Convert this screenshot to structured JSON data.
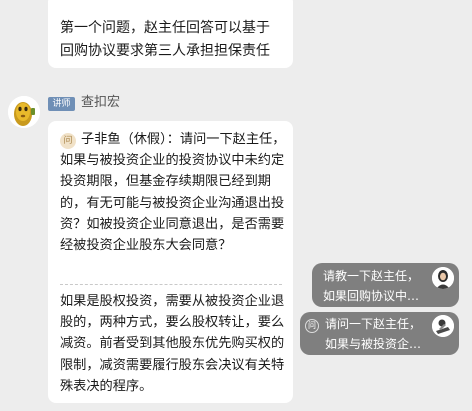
{
  "previous_message": {
    "text": "第一个问题，赵主任回答可以基于回购协议要求第三人承担担保责任"
  },
  "message": {
    "role_badge": "讲师",
    "sender": "查扣宏",
    "avatar": "yellow-cartoon-avatar",
    "quote_icon": "问",
    "quoted_question": "子非鱼（休假）：请问一下赵主任，如果与被投资企业的投资协议中未约定投资期限，但基金存续期限已经到期的，有无可能与被投资企业沟通退出投资？如被投资企业同意退出，是否需要经被投资企业股东大会同意？",
    "answer": "如果是股权投资，需要从被投资企业退股的，两种方式，要么股权转让，要么减资。前者受到其他股东优先购买权的限制，减资需要履行股东会决议有关特殊表决的程序。"
  },
  "floating_questions": [
    {
      "text": "请教一下赵主任，\n如果回购协议中…",
      "avatar": "woman-avatar"
    },
    {
      "icon": "问",
      "text": "请问一下赵主任，\n如果与被投资企…",
      "avatar": "reader-avatar"
    }
  ],
  "colors": {
    "page_background": "#ededed",
    "bubble": "#ffffff",
    "role_badge": "#6f8fb6",
    "pill_background": "#7f7f7f",
    "quote_icon_background": "#f1e2c8"
  }
}
